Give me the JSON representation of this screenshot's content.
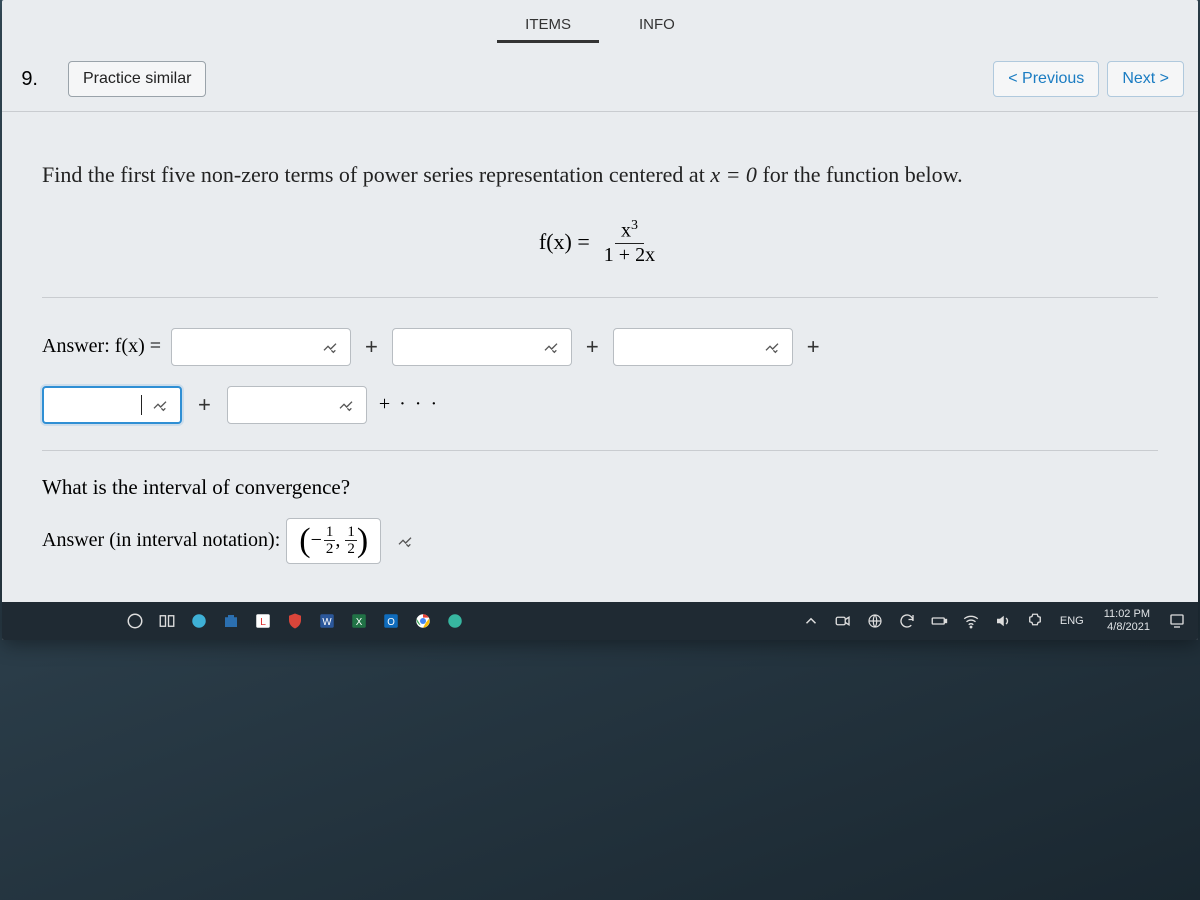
{
  "tabs": {
    "items": "ITEMS",
    "info": "INFO"
  },
  "question_number": "9.",
  "buttons": {
    "practice_similar": "Practice similar",
    "previous": "< Previous",
    "next": "Next >"
  },
  "prompt": {
    "text_before": "Find the first five non-zero terms of power series representation centered at ",
    "center": "x = 0",
    "text_after": " for the function below."
  },
  "formula": {
    "lhs": "f(x) =",
    "numerator": "x",
    "numerator_exp": "3",
    "denominator": "1 + 2x"
  },
  "answer1": {
    "label": "Answer: f(x) =",
    "plus": "+",
    "trailing": "+ · · ·",
    "active_value": ""
  },
  "question2": "What is the interval of convergence?",
  "answer2": {
    "label": "Answer (in interval notation):",
    "value_display": "(−1/2, 1/2)"
  },
  "taskbar": {
    "lang": "ENG",
    "time": "11:02 PM",
    "date": "4/8/2021"
  }
}
